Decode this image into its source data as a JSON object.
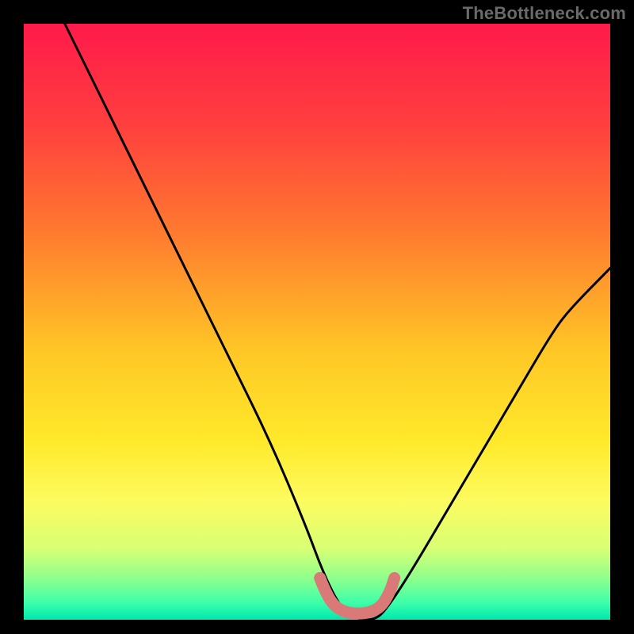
{
  "watermark": "TheBottleneck.com",
  "chart_data": {
    "type": "line",
    "title": "",
    "xlabel": "",
    "ylabel": "",
    "xlim": [
      0,
      100
    ],
    "ylim": [
      0,
      100
    ],
    "grid": false,
    "legend": false,
    "legend_position": "none",
    "background_gradient_stops": [
      {
        "pos": 0.0,
        "color": "#ff1a4b"
      },
      {
        "pos": 0.17,
        "color": "#ff3f3e"
      },
      {
        "pos": 0.35,
        "color": "#ff7a2f"
      },
      {
        "pos": 0.55,
        "color": "#ffc726"
      },
      {
        "pos": 0.7,
        "color": "#ffe92a"
      },
      {
        "pos": 0.8,
        "color": "#fdfb5f"
      },
      {
        "pos": 0.88,
        "color": "#d9ff74"
      },
      {
        "pos": 0.93,
        "color": "#8fff8c"
      },
      {
        "pos": 0.97,
        "color": "#3fffa8"
      },
      {
        "pos": 1.0,
        "color": "#00e8b0"
      }
    ],
    "series": [
      {
        "name": "bottleneck-curve",
        "color": "#000000",
        "x": [
          7.0,
          14,
          21,
          28,
          35,
          42,
          48,
          51,
          54,
          57,
          60,
          62,
          66,
          72,
          78,
          84,
          90,
          93,
          100
        ],
        "y": [
          100,
          86,
          72,
          58,
          44,
          30,
          16,
          8,
          2,
          0,
          0,
          2,
          8,
          18,
          28,
          38,
          48,
          52,
          59
        ]
      }
    ],
    "highlight": {
      "name": "optimal-range",
      "color": "#d97a78",
      "points": [
        {
          "x": 50.5,
          "y": 7.0
        },
        {
          "x": 51.5,
          "y": 4.5
        },
        {
          "x": 53.0,
          "y": 2.2
        },
        {
          "x": 55.0,
          "y": 1.2
        },
        {
          "x": 57.0,
          "y": 1.0
        },
        {
          "x": 59.0,
          "y": 1.2
        },
        {
          "x": 61.0,
          "y": 2.2
        },
        {
          "x": 62.5,
          "y": 4.8
        },
        {
          "x": 63.2,
          "y": 7.0
        }
      ]
    }
  }
}
